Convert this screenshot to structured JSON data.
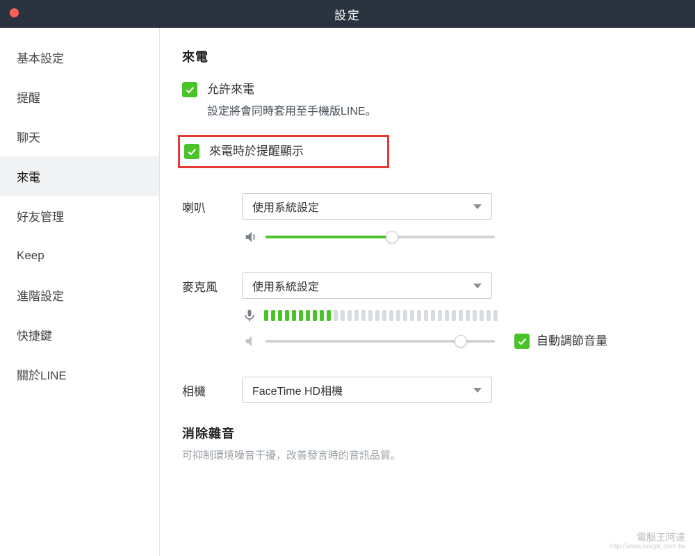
{
  "window": {
    "title": "設定"
  },
  "sidebar": {
    "items": [
      {
        "label": "基本設定"
      },
      {
        "label": "提醒"
      },
      {
        "label": "聊天"
      },
      {
        "label": "來電"
      },
      {
        "label": "好友管理"
      },
      {
        "label": "Keep"
      },
      {
        "label": "進階設定"
      },
      {
        "label": "快捷鍵"
      },
      {
        "label": "關於LINE"
      }
    ],
    "active_index": 3
  },
  "content": {
    "section_title": "來電",
    "allow_call": {
      "checked": true,
      "label": "允許來電",
      "sub": "設定將會同時套用至手機版LINE。"
    },
    "show_in_notification": {
      "checked": true,
      "label": "來電時於提醒顯示"
    },
    "speaker": {
      "label": "喇叭",
      "value": "使用系統設定",
      "volume_percent": 55
    },
    "microphone": {
      "label": "麥克風",
      "value": "使用系統設定",
      "level_segments_total": 34,
      "level_segments_active": 10,
      "gain_percent": 85,
      "auto_volume": {
        "checked": true,
        "label": "自動調節音量"
      }
    },
    "camera": {
      "label": "相機",
      "value": "FaceTime HD相機"
    },
    "noise": {
      "title": "消除雜音",
      "desc": "可抑制環境噪音干擾，改善發言時的音訊品質。"
    }
  },
  "watermark": {
    "brand": "電腦王阿達",
    "url": "http://www.kocpc.com.tw"
  }
}
